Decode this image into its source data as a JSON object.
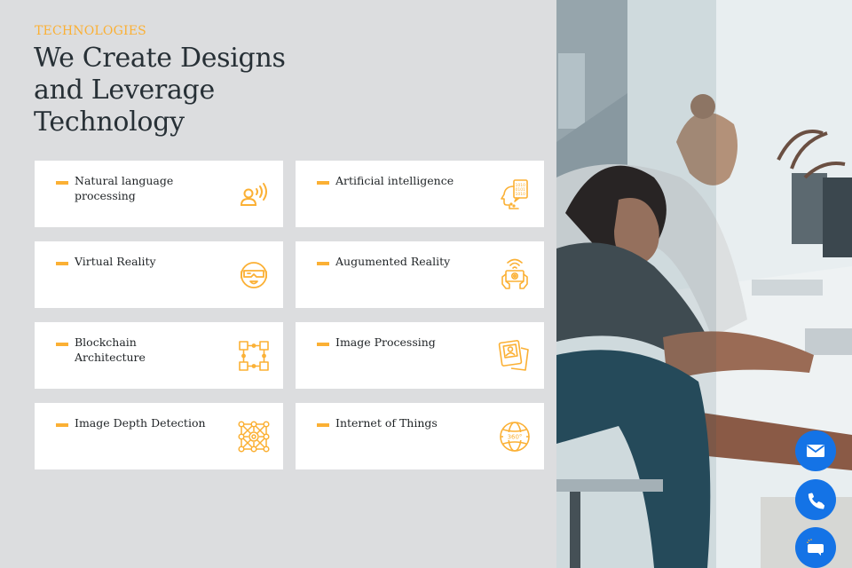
{
  "section": {
    "eyebrow": "TECHNOLOGIES",
    "headline": "We Create Designs and Leverage Technology"
  },
  "technologies": [
    {
      "label": "Natural language processing",
      "icon": "voice-recognition-icon"
    },
    {
      "label": "Artificial intelligence",
      "icon": "ai-head-binary-icon"
    },
    {
      "label": "Virtual Reality",
      "icon": "vr-headset-icon"
    },
    {
      "label": "Augumented Reality",
      "icon": "ar-tablet-icon"
    },
    {
      "label": "Blockchain Architecture",
      "icon": "blockchain-icon"
    },
    {
      "label": "Image Processing",
      "icon": "image-photos-icon"
    },
    {
      "label": "Image Depth Detection",
      "icon": "depth-network-icon"
    },
    {
      "label": "Internet of Things",
      "icon": "globe-360-icon"
    }
  ],
  "globe_icon_text": "360°",
  "contact_buttons": [
    {
      "name": "email",
      "icon": "envelope-icon"
    },
    {
      "name": "phone",
      "icon": "phone-icon"
    },
    {
      "name": "chat",
      "icon": "chat-bubble-icon"
    }
  ],
  "colors": {
    "accent": "#fbb034",
    "background": "#dcdddf",
    "card": "#ffffff",
    "heading": "#273036",
    "fab": "#1473e6"
  }
}
